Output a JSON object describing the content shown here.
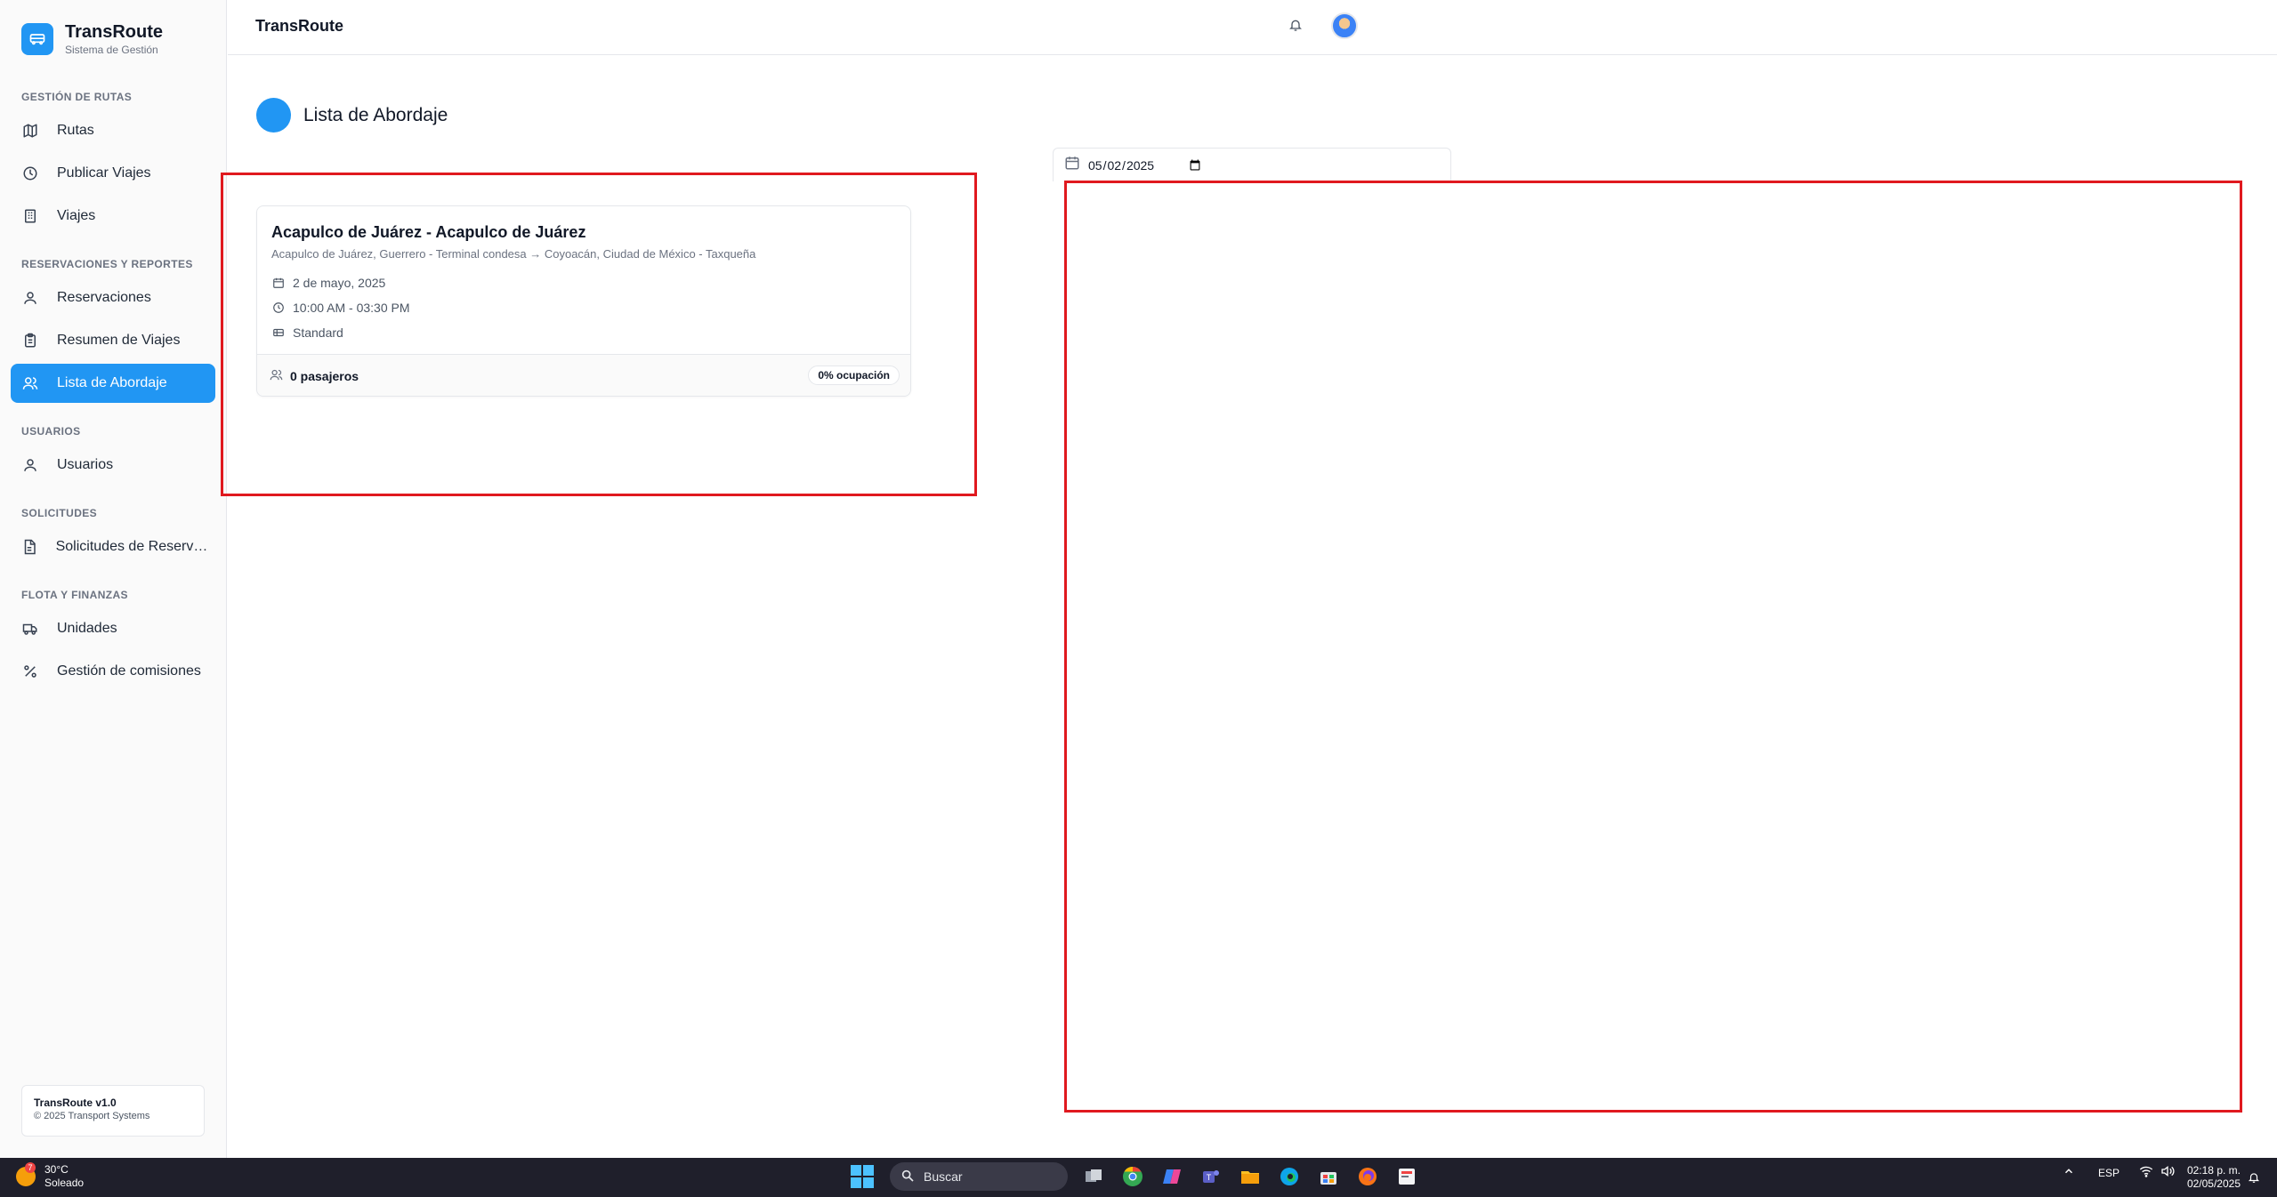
{
  "brand": {
    "title": "TransRoute",
    "subtitle": "Sistema de Gestión"
  },
  "sidebar": {
    "sections": [
      {
        "label": "GESTIÓN DE RUTAS"
      },
      {
        "label": "RESERVACIONES Y REPORTES"
      },
      {
        "label": "USUARIOS"
      },
      {
        "label": "SOLICITUDES"
      },
      {
        "label": "FLOTA Y FINANZAS"
      }
    ],
    "items": [
      {
        "label": "Rutas",
        "icon": "map-icon"
      },
      {
        "label": "Publicar Viajes",
        "icon": "clock-icon"
      },
      {
        "label": "Viajes",
        "icon": "building-icon"
      },
      {
        "label": "Reservaciones",
        "icon": "user-icon"
      },
      {
        "label": "Resumen de Viajes",
        "icon": "clipboard-icon"
      },
      {
        "label": "Lista de Abordaje",
        "icon": "users-icon",
        "active": true
      },
      {
        "label": "Usuarios",
        "icon": "user-icon"
      },
      {
        "label": "Solicitudes de Reservación",
        "icon": "file-icon"
      },
      {
        "label": "Unidades",
        "icon": "truck-icon"
      },
      {
        "label": "Gestión de comisiones",
        "icon": "percent-icon"
      }
    ],
    "footer": {
      "version": "TransRoute v1.0",
      "copyright": "© 2025 Transport Systems"
    }
  },
  "topbar": {
    "title": "TransRoute"
  },
  "page": {
    "title": "Lista de Abordaje"
  },
  "date_filter": {
    "value": "2025-05-02"
  },
  "trip_card": {
    "title": "Acapulco de Juárez - Acapulco de Juárez",
    "route": "Acapulco de Juárez, Guerrero - Terminal condesa → Coyoacán, Ciudad de México - Taxqueña",
    "date": "2 de mayo, 2025",
    "time": "10:00 AM - 03:30 PM",
    "service": "Standard",
    "passengers": "0 pasajeros",
    "occupancy": "0% ocupación"
  },
  "taskbar": {
    "weather_temp": "30°C",
    "weather_desc": "Soleado",
    "weather_badge": "7",
    "search_placeholder": "Buscar",
    "lang": "ESP",
    "time": "02:18 p. m.",
    "date": "02/05/2025"
  },
  "colors": {
    "accent": "#2196f3",
    "highlight_box": "#e0191f",
    "taskbar_bg": "#1f1f2b"
  }
}
